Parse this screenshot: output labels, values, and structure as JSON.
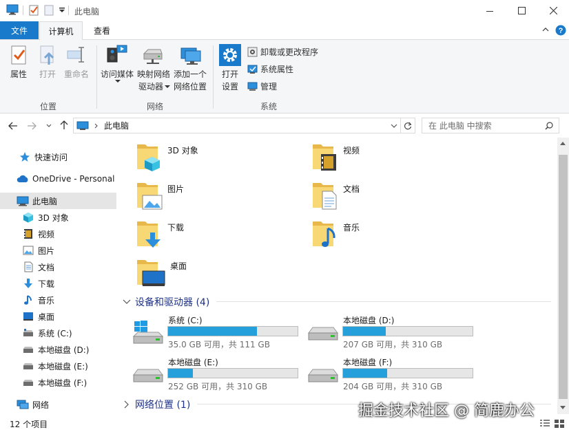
{
  "window": {
    "title": "此电脑"
  },
  "ribbon": {
    "tabs": {
      "file": "文件",
      "computer": "计算机",
      "view": "查看"
    },
    "groups": {
      "location": "位置",
      "network": "网络",
      "system": "系统"
    },
    "buttons": {
      "properties": "属性",
      "open": "打开",
      "rename": "重命名",
      "access_media_1": "访问媒体",
      "map_drive_1": "映射网络",
      "map_drive_2": "驱动器",
      "add_location_1": "添加一个",
      "add_location_2": "网络位置",
      "open_settings_1": "打开",
      "open_settings_2": "设置",
      "uninstall": "卸载或更改程序",
      "system_properties": "系统属性",
      "manage": "管理"
    }
  },
  "address": {
    "path": "此电脑",
    "search_placeholder": "在 此电脑 中搜索"
  },
  "nav": {
    "items": [
      {
        "label": "快速访问",
        "icon": "star-icon"
      },
      {
        "label": "OneDrive - Personal",
        "icon": "cloud-icon"
      },
      {
        "label": "此电脑",
        "icon": "computer-icon"
      },
      {
        "label": "3D 对象",
        "icon": "cube-icon"
      },
      {
        "label": "视频",
        "icon": "video-icon"
      },
      {
        "label": "图片",
        "icon": "picture-icon"
      },
      {
        "label": "文档",
        "icon": "document-icon"
      },
      {
        "label": "下载",
        "icon": "download-icon"
      },
      {
        "label": "音乐",
        "icon": "music-icon"
      },
      {
        "label": "桌面",
        "icon": "desktop-icon"
      },
      {
        "label": "系统 (C:)",
        "icon": "drive-icon"
      },
      {
        "label": "本地磁盘 (D:)",
        "icon": "drive-icon"
      },
      {
        "label": "本地磁盘 (E:)",
        "icon": "drive-icon"
      },
      {
        "label": "本地磁盘 (F:)",
        "icon": "drive-icon"
      },
      {
        "label": "网络",
        "icon": "network-icon"
      }
    ]
  },
  "folders": [
    {
      "name": "3D 对象",
      "icon": "cube-icon"
    },
    {
      "name": "视频",
      "icon": "video-icon"
    },
    {
      "name": "图片",
      "icon": "picture-icon"
    },
    {
      "name": "文档",
      "icon": "document-icon"
    },
    {
      "name": "下载",
      "icon": "download-icon"
    },
    {
      "name": "音乐",
      "icon": "music-icon"
    },
    {
      "name": "桌面",
      "icon": "desktop-icon"
    }
  ],
  "devices_section": {
    "title": "设备和驱动器 (4)"
  },
  "drives": [
    {
      "name": "系统 (C:)",
      "info": "35.0 GB 可用，共 111 GB",
      "used_fraction": 0.685
    },
    {
      "name": "本地磁盘 (D:)",
      "info": "207 GB 可用，共 310 GB",
      "used_fraction": 0.33
    },
    {
      "name": "本地磁盘 (E:)",
      "info": "252 GB 可用，共 310 GB",
      "used_fraction": 0.19
    },
    {
      "name": "本地磁盘 (F:)",
      "info": "204 GB 可用，共 310 GB",
      "used_fraction": 0.34
    }
  ],
  "network_section": {
    "title": "网络位置 (1)"
  },
  "status": {
    "count": "12 个项目"
  },
  "watermark": "掘金技术社区 @ 简鹿办公",
  "colors": {
    "accent": "#1979ca",
    "bar": "#26a0da",
    "folder": "#f8d775"
  }
}
